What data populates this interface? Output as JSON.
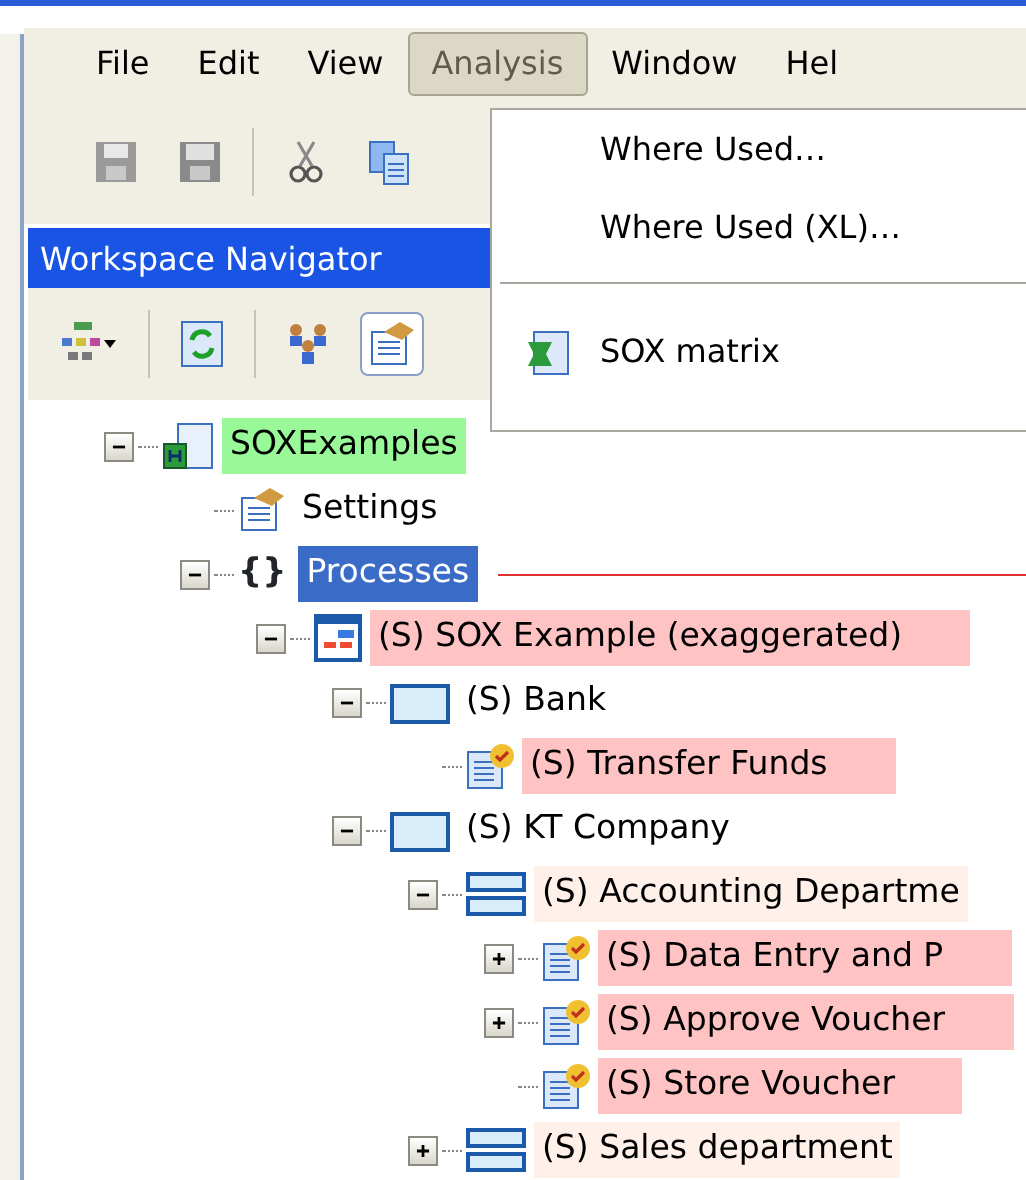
{
  "menu_bar": [
    {
      "label": "File",
      "selected": false
    },
    {
      "label": "Edit",
      "selected": false
    },
    {
      "label": "View",
      "selected": false
    },
    {
      "label": "Analysis",
      "selected": true
    },
    {
      "label": "Window",
      "selected": false
    },
    {
      "label": "Hel",
      "selected": false
    }
  ],
  "toolbar": [
    {
      "kind": "save"
    },
    {
      "kind": "save-all"
    },
    {
      "kind": "separator"
    },
    {
      "kind": "cut"
    },
    {
      "kind": "copy"
    }
  ],
  "dropdown": [
    {
      "kind": "item",
      "label": "Where Used…"
    },
    {
      "kind": "item",
      "label": "Where Used (XL)…"
    },
    {
      "kind": "separator"
    },
    {
      "kind": "spreadsheet",
      "label": "SOX matrix"
    }
  ],
  "navigator": {
    "title": "Workspace Navigator",
    "toolbar": [
      {
        "kind": "diagram",
        "pressed": false
      },
      {
        "kind": "separator"
      },
      {
        "kind": "refresh",
        "pressed": false
      },
      {
        "kind": "separator"
      },
      {
        "kind": "people",
        "pressed": false
      },
      {
        "kind": "settings",
        "pressed": true
      }
    ],
    "tree": [
      {
        "label": "SOXExamples",
        "kind": "project",
        "expanded": true,
        "selected": false,
        "color": "#99f898",
        "children": [
          {
            "label": "Settings",
            "kind": "settings",
            "selected": false
          },
          {
            "label": "Processes",
            "kind": "braces",
            "glyph": "{}",
            "expanded": true,
            "selected": true,
            "children": [
              {
                "label": "(S) SOX Example (exaggerated)",
                "kind": "process",
                "expanded": true,
                "selected": false,
                "color": "#ffc3c3",
                "children": [
                  {
                    "label": "(S) Bank",
                    "kind": "org",
                    "expanded": true,
                    "selected": false,
                    "children": [
                      {
                        "label": "(S) Transfer Funds",
                        "kind": "task",
                        "selected": false,
                        "color": "#ffc3c3"
                      }
                    ]
                  },
                  {
                    "label": "(S) KT Company",
                    "kind": "org",
                    "expanded": true,
                    "selected": false,
                    "children": [
                      {
                        "label": "(S) Accounting Departme",
                        "kind": "department",
                        "expanded": true,
                        "selected": false,
                        "color": "#fff0ea",
                        "children": [
                          {
                            "label": "(S) Data Entry and P",
                            "kind": "task",
                            "expanded": false,
                            "selected": false,
                            "color": "#ffc3c3"
                          },
                          {
                            "label": "(S) Approve Voucher",
                            "kind": "task",
                            "expanded": false,
                            "selected": false,
                            "color": "#ffc3c3"
                          },
                          {
                            "label": "(S) Store Voucher",
                            "kind": "task",
                            "selected": false,
                            "color": "#ffc3c3"
                          }
                        ]
                      },
                      {
                        "label": "(S) Sales department",
                        "kind": "department",
                        "expanded": false,
                        "selected": false,
                        "color": "#fff0ea"
                      }
                    ]
                  }
                ]
              }
            ]
          }
        ]
      }
    ]
  }
}
